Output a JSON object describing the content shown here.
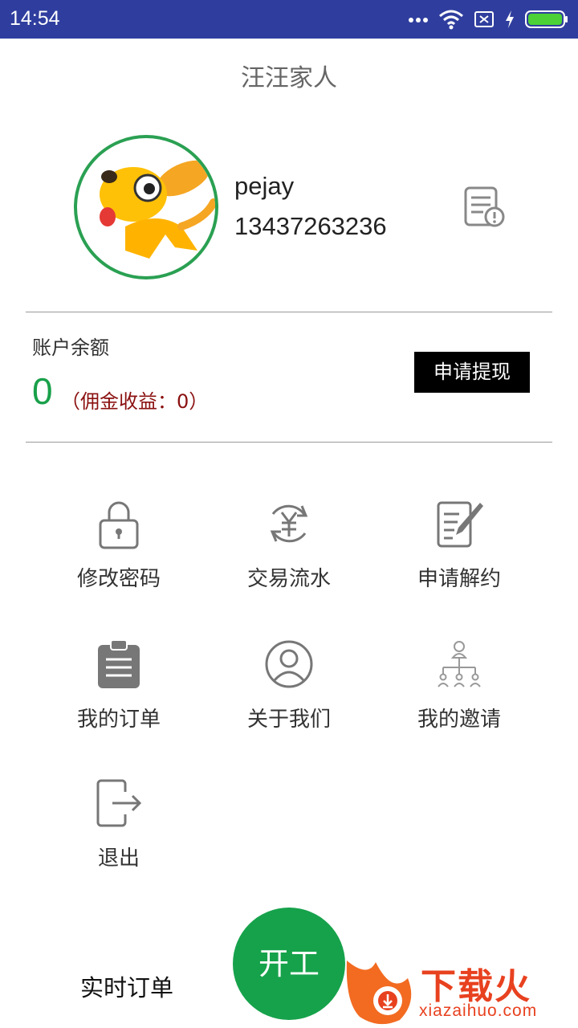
{
  "status_bar": {
    "time": "14:54",
    "icons": [
      "more-dots-icon",
      "wifi-icon",
      "sim-off-icon",
      "charging-icon",
      "battery-icon"
    ],
    "battery_color": "#4cd137"
  },
  "header": {
    "title": "汪汪家人"
  },
  "profile": {
    "name": "pejay",
    "phone": "13437263236",
    "avatar_border_color": "#2aa052"
  },
  "balance": {
    "label": "账户余额",
    "amount": "0",
    "commission": "（佣金收益：0）",
    "withdraw_label": "申请提现",
    "amount_color": "#19a04a"
  },
  "menu": {
    "items": [
      {
        "label": "修改密码",
        "icon": "lock-icon"
      },
      {
        "label": "交易流水",
        "icon": "yuan-exchange-icon"
      },
      {
        "label": "申请解约",
        "icon": "document-edit-icon"
      },
      {
        "label": "我的订单",
        "icon": "clipboard-icon"
      },
      {
        "label": "关于我们",
        "icon": "user-circle-icon"
      },
      {
        "label": "我的邀请",
        "icon": "org-chart-icon"
      },
      {
        "label": "退出",
        "icon": "logout-icon"
      }
    ]
  },
  "bottom_bar": {
    "tab_label": "实时订单",
    "fab_label": "开工",
    "fab_color": "#16a24b"
  },
  "watermark": {
    "text": "下载火",
    "url": "xiazaihuo.com"
  }
}
